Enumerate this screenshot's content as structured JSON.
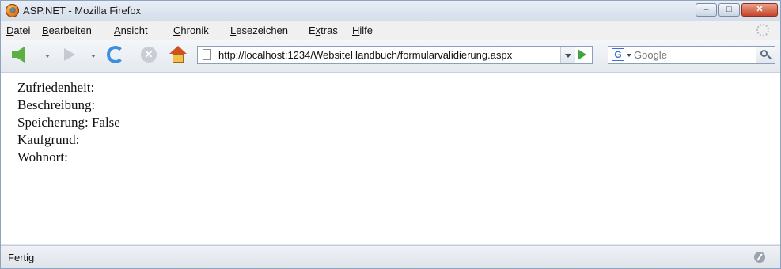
{
  "window": {
    "title": "ASP.NET - Mozilla Firefox"
  },
  "menu": {
    "items": [
      {
        "mnemonic": "D",
        "rest": "atei"
      },
      {
        "mnemonic": "B",
        "rest": "earbeiten"
      },
      {
        "mnemonic": "A",
        "rest": "nsicht"
      },
      {
        "mnemonic": "C",
        "rest": "hronik"
      },
      {
        "mnemonic": "L",
        "rest": "esezeichen"
      },
      {
        "prefix": "E",
        "mnemonic": "x",
        "rest": "tras"
      },
      {
        "mnemonic": "H",
        "rest": "ilfe"
      }
    ]
  },
  "toolbar": {
    "url": "http://localhost:1234/WebsiteHandbuch/formularvalidierung.aspx"
  },
  "search": {
    "engine_letter": "G",
    "placeholder": "Google"
  },
  "content": {
    "lines": [
      "Zufriedenheit:",
      "Beschreibung:",
      "Speicherung: False",
      "Kaufgrund:",
      "Wohnort:"
    ]
  },
  "status": {
    "text": "Fertig"
  },
  "icons": {
    "app": "firefox-icon",
    "back": "back-arrow-icon",
    "forward": "forward-arrow-icon",
    "reload": "reload-icon",
    "stop": "stop-icon",
    "home": "home-icon",
    "go": "go-arrow-icon",
    "search": "magnifier-icon"
  }
}
